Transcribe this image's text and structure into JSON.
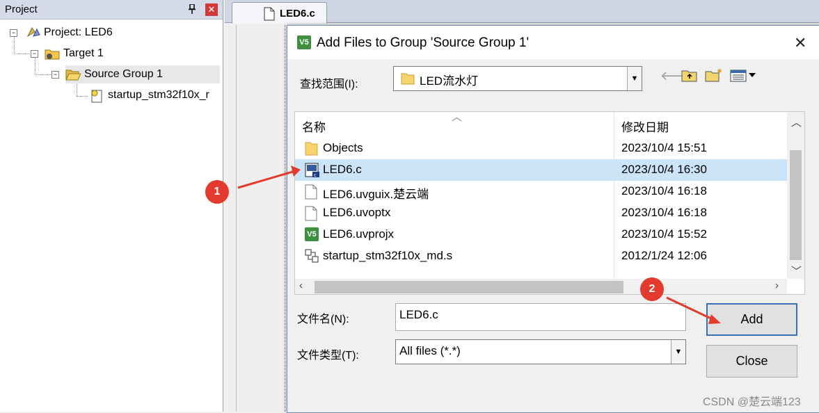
{
  "project_panel": {
    "title": "Project",
    "pin_glyph": "ᵽ",
    "close_glyph": "✕",
    "tree": [
      {
        "label": "Project: LED6",
        "icon": "project-icon"
      },
      {
        "label": "Target 1",
        "icon": "target-icon"
      },
      {
        "label": "Source Group 1",
        "icon": "folder-open-icon"
      },
      {
        "label": "startup_stm32f10x_r",
        "icon": "asm-file-icon"
      }
    ]
  },
  "editor": {
    "tab_label": "LED6.c"
  },
  "dialog": {
    "title": "Add Files to Group 'Source Group 1'",
    "app_icon_text": "V5",
    "close_glyph": "✕",
    "look_in_label": "查找范围(I):",
    "look_in_value": "LED流水灯",
    "columns": {
      "name": "名称",
      "date": "修改日期"
    },
    "files": [
      {
        "name": "Objects",
        "date": "2023/10/4 15:51",
        "icon": "folder-icon"
      },
      {
        "name": "LED6.c",
        "date": "2023/10/4 16:30",
        "icon": "c-file-icon"
      },
      {
        "name": "LED6.uvguix.楚云端",
        "date": "2023/10/4 16:18",
        "icon": "blank-file-icon"
      },
      {
        "name": "LED6.uvoptx",
        "date": "2023/10/4 16:18",
        "icon": "blank-file-icon"
      },
      {
        "name": "LED6.uvprojx",
        "date": "2023/10/4 15:52",
        "icon": "uvproj-icon"
      },
      {
        "name": "startup_stm32f10x_md.s",
        "date": "2012/1/24 12:06",
        "icon": "asm-file-icon"
      }
    ],
    "selected_index": 1,
    "filename_label": "文件名(N):",
    "filename_value": "LED6.c",
    "filetype_label": "文件类型(T):",
    "filetype_value": "All files (*.*)",
    "add_button": "Add",
    "close_button": "Close"
  },
  "annotations": {
    "marker1": "1",
    "marker2": "2",
    "arrow_color": "#e23a2d"
  },
  "watermark": "CSDN @楚云端123"
}
